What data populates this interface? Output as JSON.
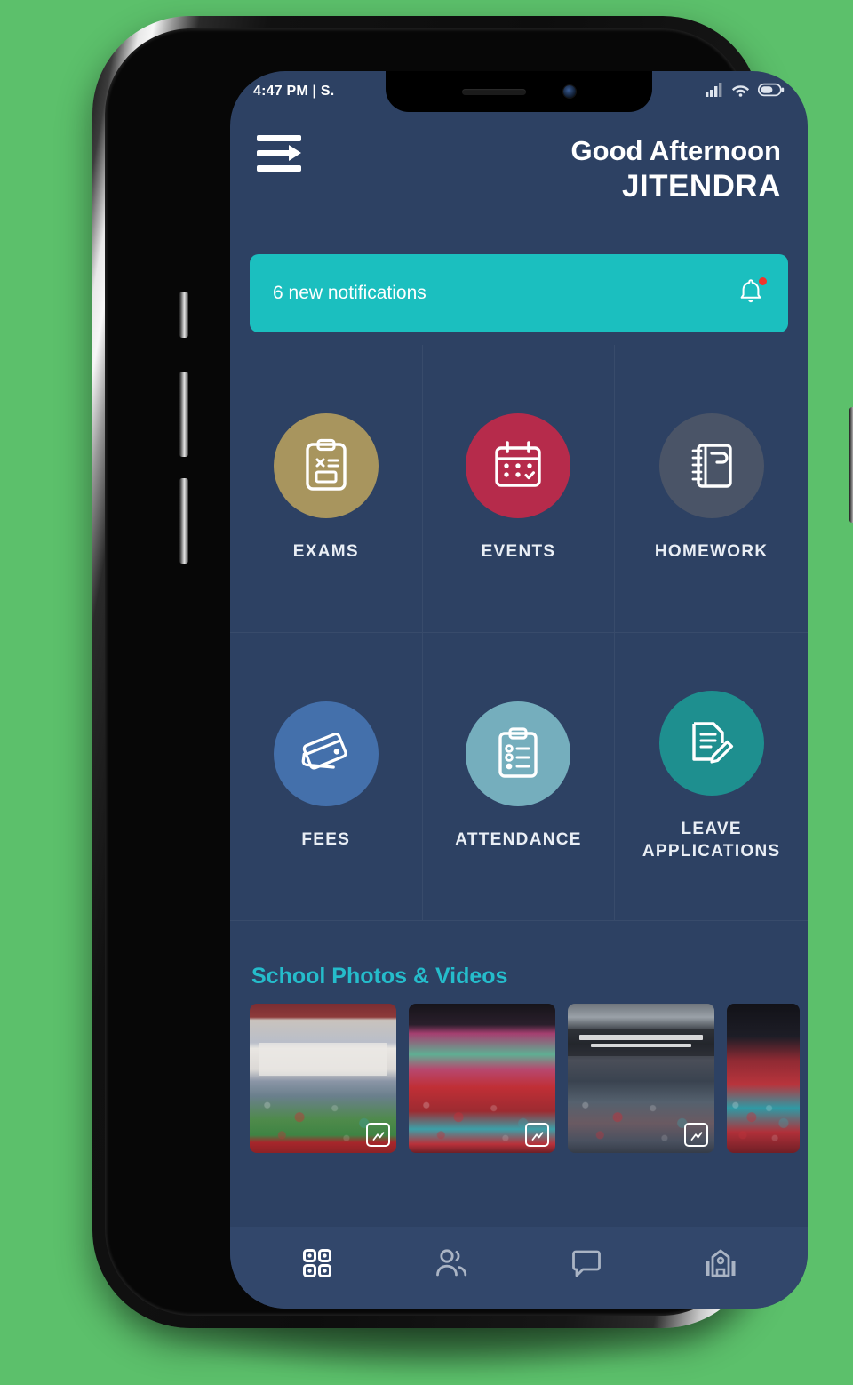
{
  "device": {
    "frame": "smartphone-mockup",
    "notch": {
      "speaker": "earpiece-speaker",
      "camera": "front-camera"
    }
  },
  "status_bar": {
    "time": "4:47 PM | S.",
    "icons": [
      "signal-icon",
      "wifi-icon",
      "battery-icon"
    ]
  },
  "header": {
    "menu_icon": "hamburger-menu-icon",
    "greeting": "Good Afternoon",
    "user_name": "JITENDRA"
  },
  "notification_banner": {
    "text": "6 new notifications",
    "icon": "bell-icon",
    "has_badge": true,
    "background_color": "#1bbfbf",
    "badge_color": "#f0342b"
  },
  "tiles": [
    {
      "label": "EXAMS",
      "icon": "clipboard-exam-icon",
      "color": "#a8955e"
    },
    {
      "label": "EVENTS",
      "icon": "calendar-icon",
      "color": "#b62b4b"
    },
    {
      "label": "HOMEWORK",
      "icon": "notebook-icon",
      "color": "#4a5467"
    },
    {
      "label": "FEES",
      "icon": "credit-cards-icon",
      "color": "#4470ab"
    },
    {
      "label": "ATTENDANCE",
      "icon": "checklist-clipboard-icon",
      "color": "#75aebd"
    },
    {
      "label": "LEAVE APPLICATIONS",
      "icon": "document-pencil-icon",
      "color": "#1e8f8f"
    }
  ],
  "photos_section": {
    "title": "School Photos & Videos",
    "title_color": "#25bccb",
    "thumbnails": [
      {
        "name": "school-event-performance-photo",
        "badge": "image-badge-icon"
      },
      {
        "name": "school-dance-troupe-photo",
        "badge": "image-badge-icon"
      },
      {
        "name": "happy-new-school-year-photo",
        "badge": "image-badge-icon"
      },
      {
        "name": "school-performers-photo",
        "badge": "image-badge-icon"
      }
    ]
  },
  "bottom_nav": {
    "items": [
      {
        "name": "dashboard",
        "icon": "grid-dashboard-icon",
        "active": true
      },
      {
        "name": "students",
        "icon": "people-icon",
        "active": false
      },
      {
        "name": "messages",
        "icon": "chat-bubble-icon",
        "active": false
      },
      {
        "name": "school",
        "icon": "school-building-icon",
        "active": false
      }
    ]
  },
  "theme": {
    "screen_background": "#2d4163",
    "nav_background": "#32476b",
    "text_primary": "#ffffff"
  }
}
